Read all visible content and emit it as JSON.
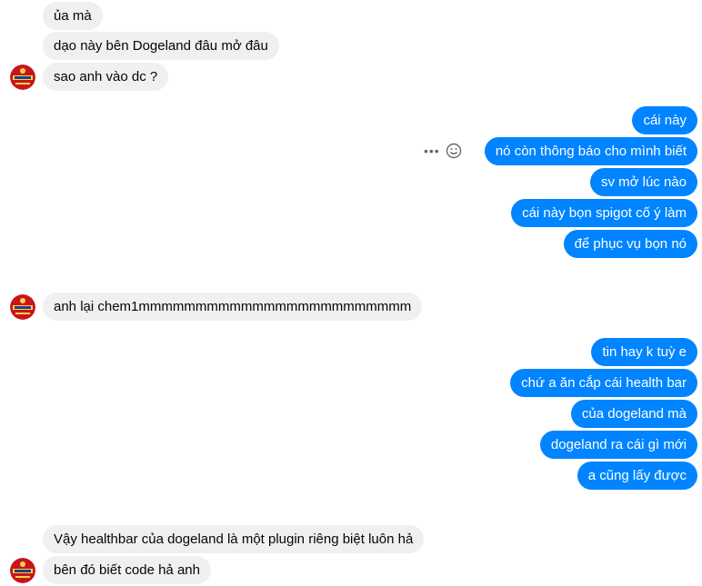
{
  "colors": {
    "incoming_bubble": "#f0f0f0",
    "outgoing_bubble": "#0084ff",
    "avatar_primary": "#c8151b"
  },
  "messages": [
    {
      "side": "in",
      "text": "ủa mà"
    },
    {
      "side": "in",
      "text": "dạo này bên Dogeland đâu mở đâu"
    },
    {
      "side": "in",
      "text": "sao anh vào dc ?"
    },
    {
      "side": "out",
      "text": "cái này"
    },
    {
      "side": "out",
      "text": "nó còn thông báo cho mình biết"
    },
    {
      "side": "out",
      "text": "sv mở lúc nào"
    },
    {
      "side": "out",
      "text": "cái này bọn spigot cố ý làm"
    },
    {
      "side": "out",
      "text": "để phục vụ bọn nó"
    },
    {
      "side": "in",
      "text": "anh lại chem1mmmmmmmmmmmmmmmmmmmmmmmm"
    },
    {
      "side": "out",
      "text": "tin hay k tuỳ e"
    },
    {
      "side": "out",
      "text": "chứ a ăn cắp cái health bar"
    },
    {
      "side": "out",
      "text": "của dogeland mà"
    },
    {
      "side": "out",
      "text": "dogeland ra cái gì mới"
    },
    {
      "side": "out",
      "text": "a cũng lấy được"
    },
    {
      "side": "in",
      "text": "Vậy healthbar của dogeland là một plugin riêng biệt luôn hả"
    },
    {
      "side": "in",
      "text": "bên đó biết code hả anh"
    }
  ],
  "actions": {
    "more_icon": "more-options-icon",
    "react_icon": "emoji-react-icon"
  },
  "avatar_icon": "contact-avatar"
}
